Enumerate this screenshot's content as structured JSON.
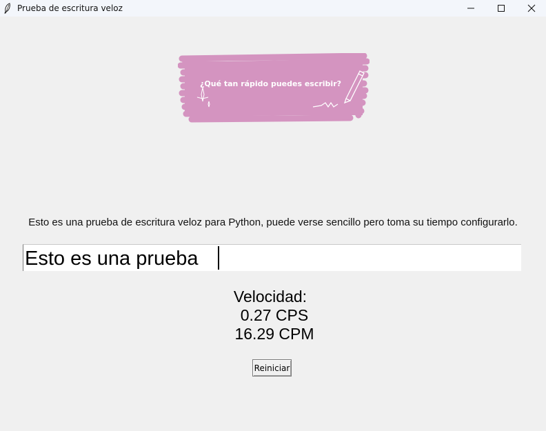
{
  "window": {
    "title": "Prueba de escritura veloz",
    "controls": [
      "minimize",
      "maximize",
      "close"
    ],
    "icon": "feather-icon"
  },
  "banner": {
    "text": "¿Qué tan rápido puedes escribir?",
    "background_color": "#d494c0",
    "decorations": [
      "pen-icon",
      "sparkle-icon"
    ]
  },
  "description": "Esto es una prueba de escritura veloz para Python, puede verse sencillo pero toma su tiempo configurarlo.",
  "typing_input": {
    "value": "Esto es una prueba "
  },
  "speed": {
    "label": "Velocidad:",
    "cps": "0.27 CPS",
    "cpm": "16.29 CPM"
  },
  "restart_button": {
    "label": "Reiniciar"
  }
}
